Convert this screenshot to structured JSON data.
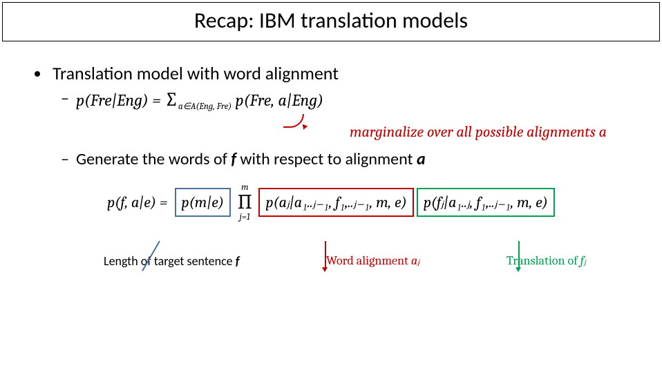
{
  "title": "Recap: IBM translation models",
  "bullet1": "Translation model with word alignment",
  "eq1": {
    "lhs": "p(Fre|Eng) = ",
    "sum_sub": "a∈A(Eng, Fre)",
    "rhs": " p(Fre, a|Eng)"
  },
  "marginal_note": "marginalize over all possible alignments a",
  "generate": {
    "pre": "Generate the words of ",
    "f": "f",
    "mid": " with respect to alignment ",
    "a": "a"
  },
  "eq2": {
    "lhs": "p(f, a|e) = ",
    "blue": "p(m|e)",
    "prod_top": "m",
    "prod_bot": "j=1",
    "red": "p(aⱼ|a₁..ⱼ₋₁, f₁,..ⱼ₋₁, m, e)",
    "green": "p(fⱼ|a₁..ⱼ, f₁,..ⱼ₋₁, m, e)"
  },
  "annotations": {
    "left": {
      "pre": "Length of target sentence ",
      "f": "f"
    },
    "mid": {
      "pre": "Word alignment ",
      "var": "aⱼ"
    },
    "right": {
      "pre": "Translation of ",
      "var": "fⱼ"
    }
  }
}
